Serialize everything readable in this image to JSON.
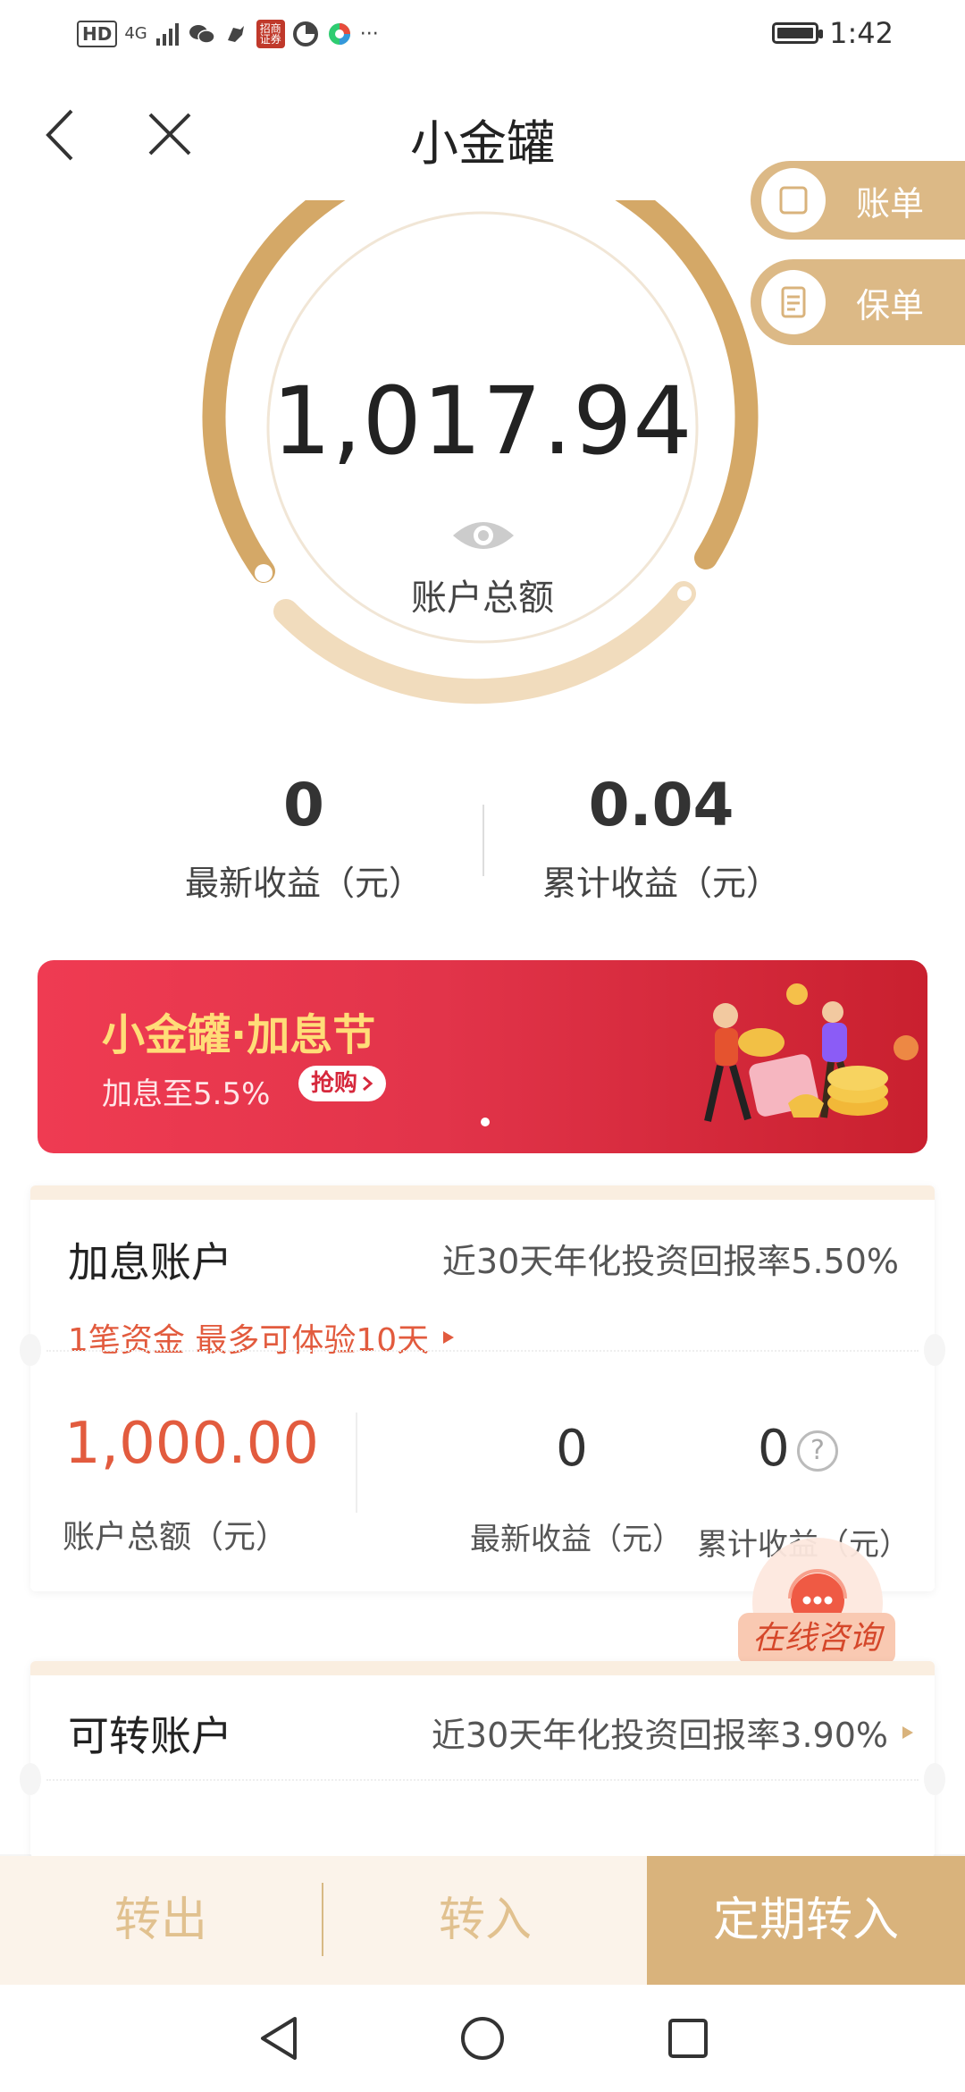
{
  "status_bar": {
    "network_hd": "HD",
    "network_4g": "4G",
    "app_badge": "招商证券",
    "more": "···",
    "time": "1:42"
  },
  "nav": {
    "title": "小金罐"
  },
  "side_buttons": {
    "statement": "账单",
    "policy": "保单"
  },
  "summary": {
    "total_amount": "1,017.94",
    "total_label": "账户总额",
    "latest_income_value": "0",
    "latest_income_label": "最新收益（元）",
    "cumulative_income_value": "0.04",
    "cumulative_income_label": "累计收益（元）"
  },
  "banner": {
    "title": "小金罐·加息节",
    "subtitle": "加息至5.5%",
    "button": "抢购"
  },
  "bonus_account": {
    "title": "加息账户",
    "rate_text": "近30天年化投资回报率5.50%",
    "note": "1笔资金 最多可体验10天",
    "amount": "1,000.00",
    "amount_label": "账户总额（元）",
    "latest_value": "0",
    "latest_label": "最新收益（元）",
    "cumulative_value": "0",
    "cumulative_label": "累计收益（元）"
  },
  "consult": {
    "label": "在线咨询"
  },
  "transferable_account": {
    "title": "可转账户",
    "rate_text": "近30天年化投资回报率3.90%"
  },
  "actions": {
    "transfer_out": "转出",
    "transfer_in": "转入",
    "fixed_transfer_in": "定期转入"
  },
  "colors": {
    "gold": "#d9b37c",
    "orange_red": "#e25b3e",
    "banner_red": "#e2344a"
  }
}
